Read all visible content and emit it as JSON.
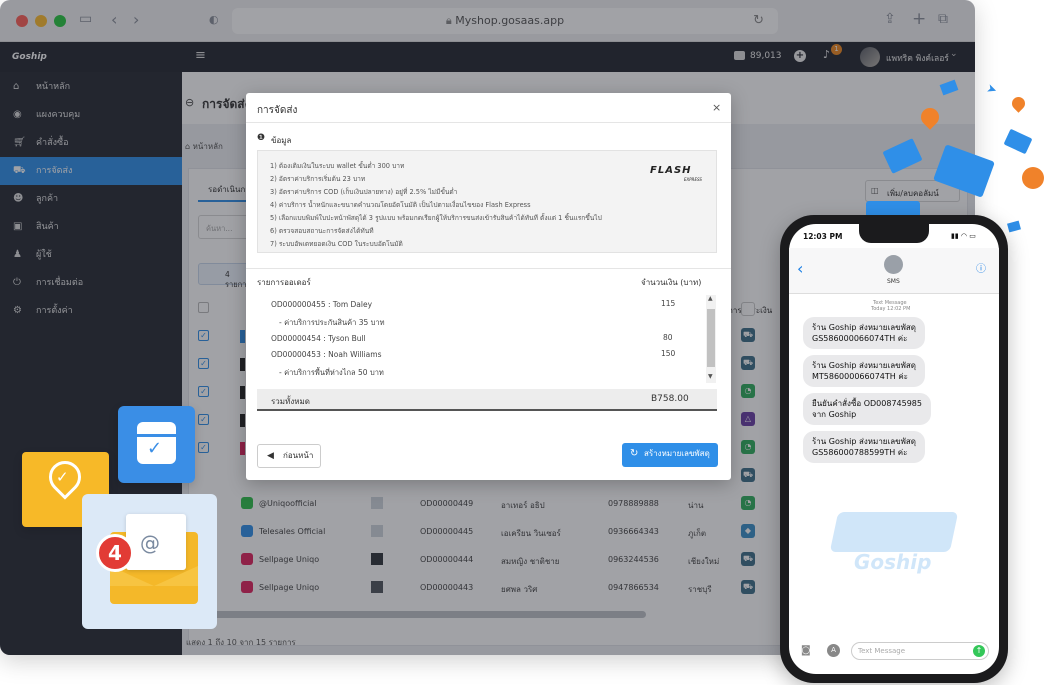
{
  "browser": {
    "url": "Myshop.gosaas.app"
  },
  "topnav": {
    "balance": "89,013",
    "notification_count": "1",
    "user_name": "แพทริค พิงค์เลอร์"
  },
  "sidebar": {
    "logo": "Goship",
    "items": [
      {
        "label": "หน้าหลัก",
        "icon": "home-icon"
      },
      {
        "label": "แผงควบคุม",
        "icon": "dashboard-icon"
      },
      {
        "label": "คำสั่งซื้อ",
        "icon": "cart-icon"
      },
      {
        "label": "การจัดส่ง",
        "icon": "truck-icon"
      },
      {
        "label": "ลูกค้า",
        "icon": "users-icon"
      },
      {
        "label": "สินค้า",
        "icon": "box-icon"
      },
      {
        "label": "ผู้ใช้",
        "icon": "user-icon"
      },
      {
        "label": "การเชื่อมต่อ",
        "icon": "plug-icon"
      },
      {
        "label": "การตั้งค่า",
        "icon": "gear-icon"
      }
    ]
  },
  "page": {
    "title": "การจัดส่ง",
    "breadcrumb_home": "หน้าหลัก",
    "tab_pending": "รอดำเนินการ",
    "search_placeholder": "ค้นหา...",
    "selected_count": "4 รายการ",
    "add_column": "เพิ่ม/ลบคอลัมน์",
    "col_payment": "การชำระเงิน",
    "footer": "แสดง 1 ถึง 10 จาก 15 รายการ"
  },
  "rows": [
    {
      "channel": "@Uniqoofficial",
      "order": "OD00000449",
      "name": "อาเทอร์ อธิป",
      "phone": "0978889888",
      "province": "น่าน"
    },
    {
      "channel": "Telesales Official",
      "order": "OD00000445",
      "name": "เอเครียน วินเซอร์",
      "phone": "0936664343",
      "province": "ภูเก็ต"
    },
    {
      "channel": "Sellpage Uniqo",
      "order": "OD00000444",
      "name": "สมหญิง ชาติชาย",
      "phone": "0963244536",
      "province": "เชียงใหม่"
    },
    {
      "channel": "Sellpage Uniqo",
      "order": "OD00000443",
      "name": "ยศพล วริศ",
      "phone": "0947866534",
      "province": "ราชบุรี"
    }
  ],
  "modal": {
    "title": "การจัดส่ง",
    "close": "×",
    "info_heading": "ข้อมูล",
    "carrier_logo": "FLASH",
    "carrier_sub": "EXPRESS",
    "info_lines": [
      "1) ต้องเติมเงินในระบบ wallet ขั้นต่ำ 300 บาท",
      "2) อัตราค่าบริการเริ่มต้น 23 บาท",
      "3) อัตราค่าบริการ COD (เก็บเงินปลายทาง) อยู่ที่ 2.5% ไม่มีขั้นต่ำ",
      "4) ค่าบริการ น้ำหนักและขนาดคำนวณโดยอัตโนมัติ เป็นไปตามเงื่อนไขของ Flash Express",
      "5) เลือกแบบพิมพ์ใบปะหน้าพัสดุได้ 3 รูปแบบ พร้อมกดเรียกผู้ให้บริการขนส่งเข้ารับสินค้าได้ทันที ตั้งแต่ 1 ชิ้นแรกขึ้นไป",
      "6) ตรวจสอบสถานะการจัดส่งได้ทันที",
      "7) ระบบอัพเดทยอดเงิน COD ในระบบอัตโนมัติ"
    ],
    "col_orders": "รายการออเดอร์",
    "col_amount": "จำนวนเงิน (บาท)",
    "orders": [
      {
        "text": "OD000000455 : Tom Daley",
        "amount": "115"
      },
      {
        "text": "- ค่าบริการประกันสินค้า 35 บาท",
        "amount": ""
      },
      {
        "text": "OD00000454 : Tyson Bull",
        "amount": "80"
      },
      {
        "text": "OD00000453 : Noah Williams",
        "amount": "150"
      },
      {
        "text": "- ค่าบริการพื้นที่ห่างไกล 50 บาท",
        "amount": ""
      }
    ],
    "total_label": "รวมทั้งหมด",
    "total_value": "B758.00",
    "back_button": "ก่อนหน้า",
    "create_button": "สร้างหมายเลขพัสดุ"
  },
  "phone": {
    "time": "12:03 PM",
    "contact": "SMS",
    "header_label": "Text Message",
    "header_time": "Today 12:02 PM",
    "messages": [
      {
        "line1": "ร้าน Goship ส่งหมายเลขพัสดุ",
        "line2": "GS586000066074TH ค่ะ"
      },
      {
        "line1": "ร้าน Goship ส่งหมายเลขพัสดุ",
        "line2": "MT586000066074TH ค่ะ"
      },
      {
        "line1": "ยืนยันคำสั่งซื้อ OD008745985",
        "line2": "จาก Goship"
      },
      {
        "line1": "ร้าน Goship ส่งหมายเลขพัสดุ",
        "line2": "GS586000788599TH ค่ะ"
      }
    ],
    "input_placeholder": "Text Message",
    "watermark": "Goship"
  },
  "badge": {
    "count": "4",
    "at": "@"
  },
  "colors": {
    "accent": "#2f8fe8",
    "sidebar": "#262a33",
    "topbar": "#23272f",
    "yellow": "#f7b928"
  }
}
